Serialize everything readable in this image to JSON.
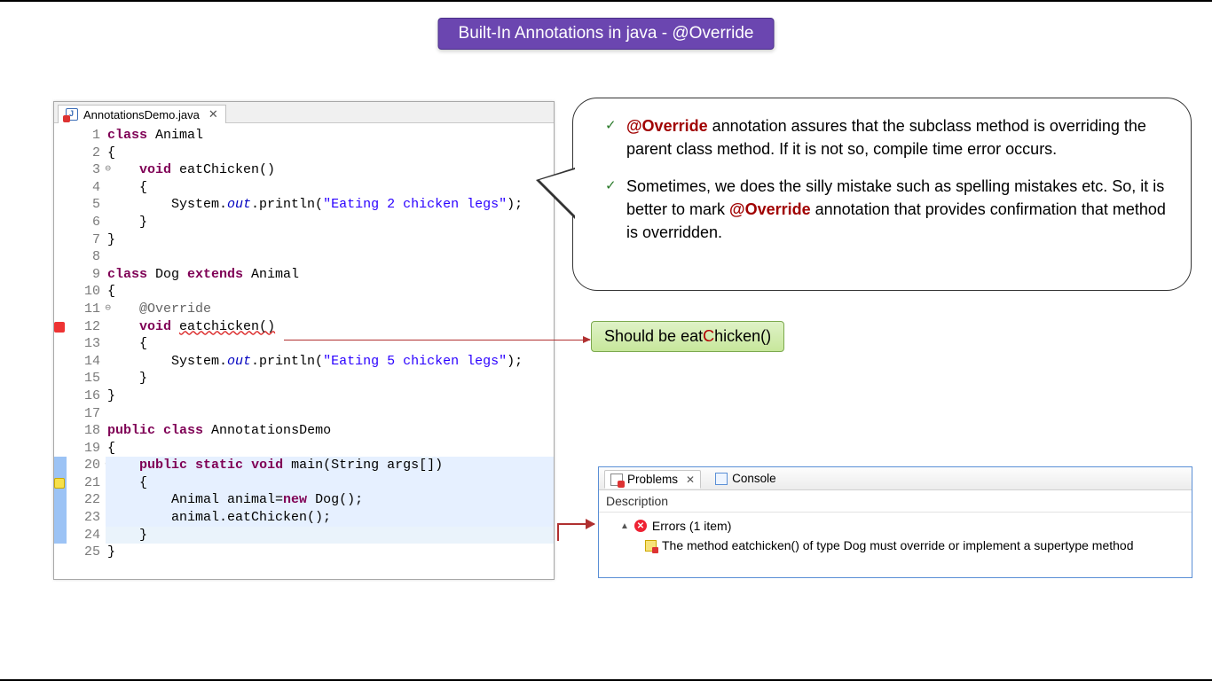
{
  "title": "Built-In Annotations in java - @Override",
  "editor": {
    "filename": "AnnotationsDemo.java",
    "lines": [
      {
        "n": 1,
        "html": "<span class='kw'>class</span> Animal"
      },
      {
        "n": 2,
        "html": "{"
      },
      {
        "n": 3,
        "fold": true,
        "html": "    <span class='kw'>void</span> eatChicken()"
      },
      {
        "n": 4,
        "html": "    {"
      },
      {
        "n": 5,
        "html": "        System.<span class='fld'>out</span>.println(<span class='str'>\"Eating 2 chicken legs\"</span>);"
      },
      {
        "n": 6,
        "html": "    }"
      },
      {
        "n": 7,
        "html": "}"
      },
      {
        "n": 8,
        "html": ""
      },
      {
        "n": 9,
        "html": "<span class='kw'>class</span> Dog <span class='kw'>extends</span> Animal"
      },
      {
        "n": 10,
        "html": "{"
      },
      {
        "n": 11,
        "fold": true,
        "html": "    <span class='ann'>@Override</span>"
      },
      {
        "n": 12,
        "marker": "err",
        "html": "    <span class='kw'>void</span> <span class='id-u'>eatchicken()</span>"
      },
      {
        "n": 13,
        "html": "    {"
      },
      {
        "n": 14,
        "html": "        System.<span class='fld'>out</span>.println(<span class='str'>\"Eating 5 chicken legs\"</span>);"
      },
      {
        "n": 15,
        "html": "    }"
      },
      {
        "n": 16,
        "html": "}"
      },
      {
        "n": 17,
        "html": ""
      },
      {
        "n": 18,
        "html": "<span class='kw'>public</span> <span class='kw'>class</span> AnnotationsDemo"
      },
      {
        "n": 19,
        "html": "{"
      },
      {
        "n": 20,
        "fold": true,
        "hl": true,
        "html": "    <span class='kw'>public</span> <span class='kw'>static</span> <span class='kw'>void</span> main(String args[])"
      },
      {
        "n": 21,
        "hl": true,
        "marker": "warn",
        "html": "    {"
      },
      {
        "n": 22,
        "hl": true,
        "html": "        Animal animal=<span class='kw'>new</span> Dog();"
      },
      {
        "n": 23,
        "hl": true,
        "html": "        animal.eatChicken();"
      },
      {
        "n": 24,
        "hl": true,
        "cur": true,
        "html": "    }"
      },
      {
        "n": 25,
        "html": "}"
      }
    ]
  },
  "bubble": {
    "p1_pre": "@Override",
    "p1_post": " annotation assures that the subclass method is overriding the parent class method. If it is not so, compile time error occurs.",
    "p2_pre": "Sometimes, we does the silly mistake such as spelling mistakes etc. So, it is better to mark ",
    "p2_mid": "@Override",
    "p2_post": " annotation that provides confirmation that method is overridden."
  },
  "hint": {
    "pre": "Should be eat",
    "c": "C",
    "post": "hicken()"
  },
  "problems": {
    "tab_label": "Problems",
    "console_label": "Console",
    "col_header": "Description",
    "group": "Errors (1 item)",
    "item": "The method eatchicken() of type Dog must override or implement a supertype method"
  }
}
